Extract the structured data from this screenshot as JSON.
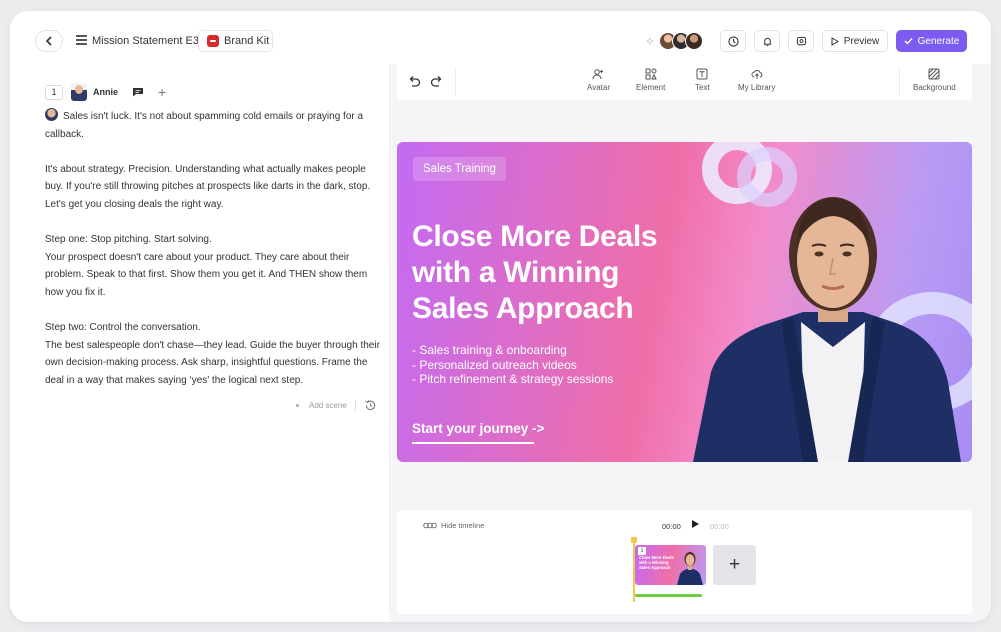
{
  "header": {
    "doc_title": "Mission Statement E3",
    "brand_kit_label": "Brand Kit",
    "preview_label": "Preview",
    "generate_label": "Generate",
    "accent_color": "#7c5cf0"
  },
  "script_panel": {
    "scene_number": "1",
    "avatar_name": "Annie",
    "paragraphs": [
      [
        "Sales isn't luck. It's not about spamming cold emails or praying for a callback."
      ],
      [
        "It's about strategy. Precision. Understanding what actually makes people buy. If you're still throwing pitches at prospects like darts in the dark, stop. Let's get you closing deals the right way."
      ],
      [
        "Step one: Stop pitching. Start solving.",
        " Your prospect doesn't care about your product. They care about their problem. Speak to that first. Show them you get it. And THEN show them how you fix it."
      ],
      [
        "Step two: Control the conversation.",
        " The best salespeople don't chase—they lead. Guide the buyer through their own decision-making process. Ask sharp, insightful questions. Frame the deal in a way that makes saying ‘yes’ the logical next step."
      ]
    ],
    "add_scene_label": "Add scene"
  },
  "toolbar": {
    "tools": [
      {
        "name": "avatar",
        "label": "Avatar",
        "icon": "add-person-icon"
      },
      {
        "name": "element",
        "label": "Element",
        "icon": "shapes-icon"
      },
      {
        "name": "text",
        "label": "Text",
        "icon": "text-icon"
      },
      {
        "name": "library",
        "label": "My Library",
        "icon": "cloud-upload-icon"
      }
    ],
    "background_label": "Background"
  },
  "slide": {
    "badge": "Sales Training",
    "title": "Close More Deals with a Winning Sales Approach",
    "bullets": [
      "- Sales training & onboarding",
      "- Personalized outreach videos",
      "- Pitch refinement & strategy sessions"
    ],
    "cta": "Start your journey ->"
  },
  "timeline": {
    "hide_label": "Hide timeline",
    "current_time": "00:00",
    "total_time": "00:00",
    "clip_number": "1",
    "clip_title": "Close More Deals with a Winning Sales Approach"
  }
}
